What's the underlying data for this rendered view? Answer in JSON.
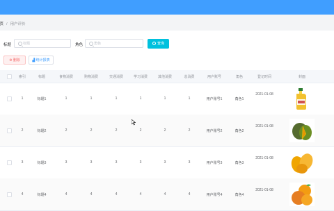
{
  "breadcrumb": {
    "home": "首页",
    "separator": "/",
    "current": "用户评价"
  },
  "search": {
    "title_label": "标题",
    "title_placeholder": "标题",
    "role_label": "角色",
    "role_placeholder": "角色",
    "search_button": "查询"
  },
  "toolbar": {
    "delete_button": "删除",
    "stats_button": "统计报表"
  },
  "table": {
    "columns": [
      "索引",
      "标题",
      "食物消费",
      "购物消费",
      "交通消费",
      "学习消费",
      "其他消费",
      "总消费",
      "用户账号",
      "角色",
      "登记时间",
      "封面"
    ],
    "rows": [
      {
        "index": "1",
        "title": "标题1",
        "food": "1",
        "shopping": "1",
        "traffic": "1",
        "study": "1",
        "other": "1",
        "total": "1",
        "account": "用户账号1",
        "role": "角色1",
        "date": "2021-01-08",
        "cover": "oil-bottle-image"
      },
      {
        "index": "2",
        "title": "标题2",
        "food": "2",
        "shopping": "2",
        "traffic": "2",
        "study": "2",
        "other": "2",
        "total": "2",
        "account": "用户账号2",
        "role": "角色2",
        "date": "2021-01-08",
        "cover": "mango-image"
      },
      {
        "index": "3",
        "title": "标题3",
        "food": "3",
        "shopping": "3",
        "traffic": "3",
        "study": "3",
        "other": "3",
        "total": "3",
        "account": "用户账号3",
        "role": "角色3",
        "date": "2021-01-08",
        "cover": "mango-yellow-image"
      },
      {
        "index": "4",
        "title": "标题4",
        "food": "4",
        "shopping": "4",
        "traffic": "4",
        "study": "4",
        "other": "4",
        "total": "4",
        "account": "用户账号4",
        "role": "角色4",
        "date": "2021-01-08",
        "cover": "apricot-image"
      }
    ]
  },
  "colors": {
    "primary": "#409eff",
    "search": "#00c1de",
    "danger": "#f56c6c"
  }
}
